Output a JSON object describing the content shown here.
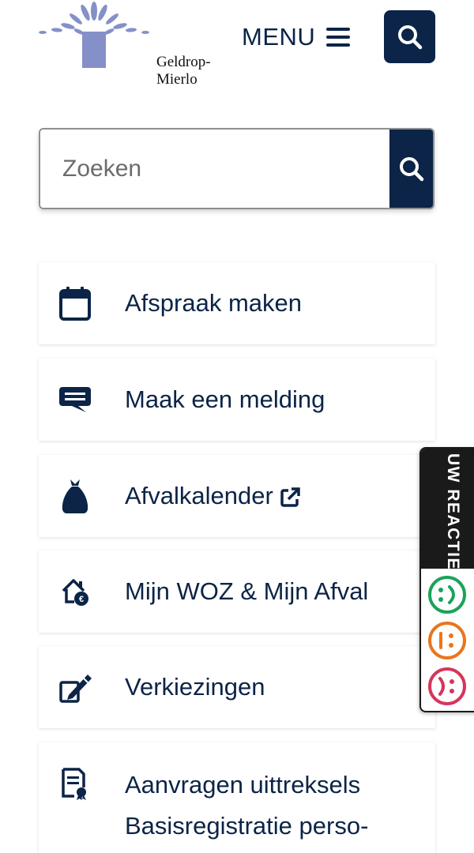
{
  "header": {
    "logo_text": "Geldrop-Mierlo",
    "menu_label": "MENU",
    "search_icon": "search-icon"
  },
  "search": {
    "placeholder": "Zoeken",
    "value": ""
  },
  "tiles": [
    {
      "label": "Afspraak maken",
      "icon": "calendar-icon"
    },
    {
      "label": "Maak een melding",
      "icon": "chat-bubble-icon"
    },
    {
      "label": "Afvalkalender",
      "icon": "trash-bag-icon",
      "external": true
    },
    {
      "label": "Mijn WOZ & Mijn Afval",
      "icon": "house-euro-icon"
    },
    {
      "label": "Verkiezingen",
      "icon": "ballot-pencil-icon"
    },
    {
      "label": "Aanvragen uittreksels Basisregistratie perso-",
      "icon": "certificate-icon"
    }
  ],
  "feedback": {
    "label": "UW REACTIE",
    "options": [
      "positive",
      "neutral",
      "negative"
    ]
  },
  "colors": {
    "navy": "#0b2447",
    "logo_purple": "#8590c8",
    "green": "#1aa35a",
    "orange": "#e8761e",
    "red": "#d6355b"
  }
}
